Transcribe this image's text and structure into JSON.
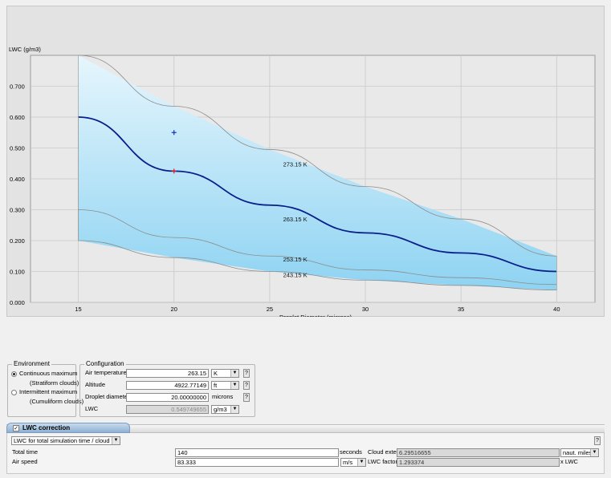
{
  "chart_data": {
    "type": "line",
    "ylabel": "LWC (g/m3)",
    "xlabel": "Droplet Diameter (microns)",
    "xlim": [
      12.5,
      42
    ],
    "ylim": [
      0,
      0.8
    ],
    "xticks": [
      "15",
      "20",
      "25",
      "30",
      "35",
      "40"
    ],
    "yticks": [
      "0.000",
      "0.100",
      "0.200",
      "0.300",
      "0.400",
      "0.500",
      "0.600",
      "0.700"
    ],
    "grid": true,
    "x": [
      15,
      20,
      25,
      30,
      35,
      40
    ],
    "series": [
      {
        "name": "273.15 K",
        "values": [
          0.8,
          0.635,
          0.495,
          0.375,
          0.27,
          0.15
        ],
        "color": "#8c8c8c"
      },
      {
        "name": "263.15 K",
        "values": [
          0.6,
          0.425,
          0.315,
          0.225,
          0.16,
          0.1
        ],
        "color": "#0a1f8a"
      },
      {
        "name": "253.15 K",
        "values": [
          0.3,
          0.21,
          0.15,
          0.105,
          0.08,
          0.058
        ],
        "color": "#8c8c8c"
      },
      {
        "name": "243.15 K",
        "values": [
          0.2,
          0.145,
          0.1,
          0.072,
          0.055,
          0.04
        ],
        "color": "#8c8c8c"
      }
    ],
    "series_labels": [
      {
        "text": "273.15 K",
        "x": 25.7,
        "y": 0.44
      },
      {
        "text": "263.15 K",
        "x": 25.7,
        "y": 0.262
      },
      {
        "text": "253.15 K",
        "x": 25.7,
        "y": 0.132
      },
      {
        "text": "243.15 K",
        "x": 25.7,
        "y": 0.082
      }
    ],
    "markers": [
      {
        "x": 20,
        "y": 0.55,
        "color": "#1a2fb0"
      },
      {
        "x": 20,
        "y": 0.425,
        "color": "#d42020"
      }
    ],
    "fill_colors": [
      "#e6f6fd",
      "#8ed3f2"
    ]
  },
  "environment": {
    "legend": "Environment",
    "option1_line1": "Continuous maximum",
    "option1_line2": "(Stratiform clouds)",
    "option2_line1": "Intermittent maximum",
    "option2_line2": "(Cumuliform clouds)",
    "selected": 1
  },
  "configuration": {
    "legend": "Configuration",
    "air_temperature_label": "Air temperature",
    "air_temperature_value": "263.15",
    "air_temperature_unit": "K",
    "altitude_label": "Altitude",
    "altitude_value": "4922.77149",
    "altitude_unit": "ft",
    "droplet_diameter_label": "Droplet diameter",
    "droplet_diameter_value": "20.00000000",
    "droplet_diameter_unit": "microns",
    "lwc_label": "LWC",
    "lwc_value": "0.549749655",
    "lwc_unit": "g/m3",
    "info_button": "?"
  },
  "lwc_correction": {
    "checkbox_mark": "✓",
    "checked": true,
    "title": "LWC correction",
    "mode_value": "LWC for total simulation time / cloud type",
    "total_time_label": "Total time",
    "total_time_value": "140",
    "total_time_unit": "seconds",
    "air_speed_label": "Air speed",
    "air_speed_value": "83.333",
    "air_speed_unit": "m/s",
    "cloud_extent_label": "Cloud extent",
    "cloud_extent_value": "6.29516655",
    "cloud_extent_unit": "naut. miles",
    "lwc_factor_label": "LWC factor:",
    "lwc_factor_value": "1.293374",
    "lwc_factor_suffix": "x LWC",
    "info_button": "?"
  }
}
